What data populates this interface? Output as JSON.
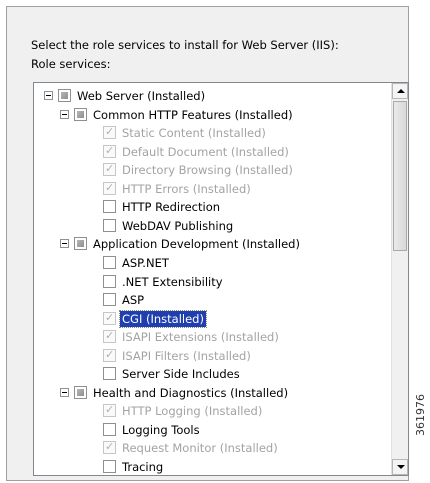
{
  "dialog": {
    "instruction": "Select the role services to install for Web Server (IIS):",
    "sublabel": "Role services:"
  },
  "tree": {
    "items": [
      {
        "label": "Web Server  (Installed)",
        "level": 0,
        "expander": true,
        "check": "tri",
        "disabled": false
      },
      {
        "label": "Common HTTP Features  (Installed)",
        "level": 1,
        "expander": true,
        "check": "tri",
        "disabled": false
      },
      {
        "label": "Static Content  (Installed)",
        "level": 2,
        "check": "checked",
        "disabled": true
      },
      {
        "label": "Default Document  (Installed)",
        "level": 2,
        "check": "checked",
        "disabled": true
      },
      {
        "label": "Directory Browsing  (Installed)",
        "level": 2,
        "check": "checked",
        "disabled": true
      },
      {
        "label": "HTTP Errors  (Installed)",
        "level": 2,
        "check": "checked",
        "disabled": true
      },
      {
        "label": "HTTP Redirection",
        "level": 2,
        "check": "none",
        "disabled": false
      },
      {
        "label": "WebDAV Publishing",
        "level": 2,
        "check": "none",
        "disabled": false
      },
      {
        "label": "Application Development  (Installed)",
        "level": 1,
        "expander": true,
        "check": "tri",
        "disabled": false
      },
      {
        "label": "ASP.NET",
        "level": 2,
        "check": "none",
        "disabled": false
      },
      {
        "label": ".NET Extensibility",
        "level": 2,
        "check": "none",
        "disabled": false
      },
      {
        "label": "ASP",
        "level": 2,
        "check": "none",
        "disabled": false
      },
      {
        "label": "CGI  (Installed)",
        "level": 2,
        "check": "checked",
        "disabled": true,
        "selected": true
      },
      {
        "label": "ISAPI Extensions  (Installed)",
        "level": 2,
        "check": "checked",
        "disabled": true
      },
      {
        "label": "ISAPI Filters  (Installed)",
        "level": 2,
        "check": "checked",
        "disabled": true
      },
      {
        "label": "Server Side Includes",
        "level": 2,
        "check": "none",
        "disabled": false
      },
      {
        "label": "Health and Diagnostics  (Installed)",
        "level": 1,
        "expander": true,
        "check": "tri",
        "disabled": false
      },
      {
        "label": "HTTP Logging  (Installed)",
        "level": 2,
        "check": "checked",
        "disabled": true
      },
      {
        "label": "Logging Tools",
        "level": 2,
        "check": "none",
        "disabled": false
      },
      {
        "label": "Request Monitor  (Installed)",
        "level": 2,
        "check": "checked",
        "disabled": true
      },
      {
        "label": "Tracing",
        "level": 2,
        "check": "none",
        "disabled": false
      }
    ]
  },
  "figure_id": "361976"
}
